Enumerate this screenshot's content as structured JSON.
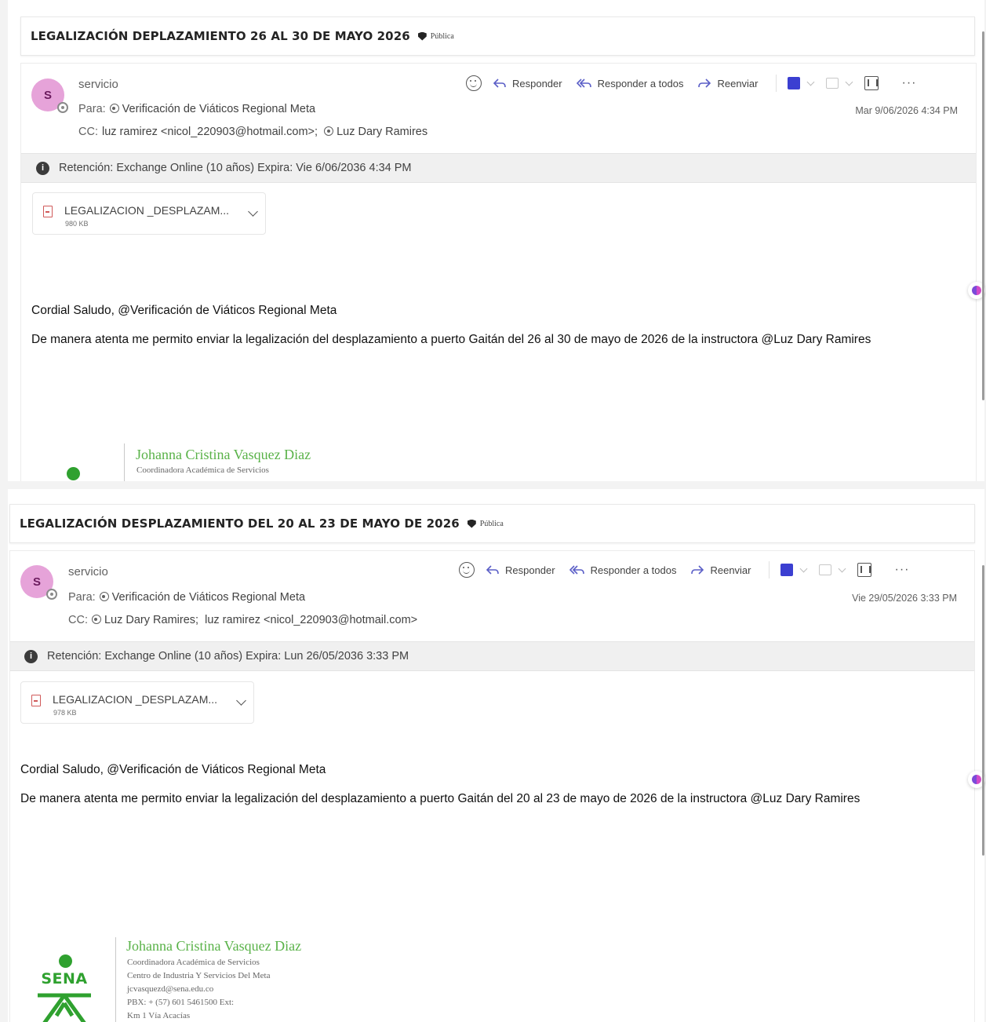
{
  "messages": [
    {
      "subject": "LEGALIZACIÓN DEPLAZAMIENTO 26 AL 30 DE MAYO 2026",
      "sensitivity": "Pública",
      "avatar_initial": "S",
      "sender": "servicio",
      "to_label": "Para:",
      "to": "Verificación de Viáticos Regional Meta",
      "cc_label": "CC:",
      "cc": [
        {
          "name": "luz ramirez <nicol_220903@hotmail.com>;",
          "icon": false
        },
        {
          "name": "Luz Dary Ramires",
          "icon": true
        }
      ],
      "date": "Mar 9/06/2026 4:34 PM",
      "retention": "Retención: Exchange Online (10 años) Expira: Vie 6/06/2036 4:34 PM",
      "attachment": {
        "name": "LEGALIZACION _DESPLAZAM...",
        "size": "980 KB"
      },
      "greeting": "Cordial Saludo, @Verificación de Viáticos Regional Meta",
      "body": "De manera atenta me permito enviar la legalización del desplazamiento a puerto Gaitán del 26 al 30 de mayo de 2026 de la instructora @Luz Dary Ramires",
      "signature": {
        "name": "Johanna Cristina Vasquez Diaz",
        "lines": [
          "Coordinadora Académica de Servicios"
        ]
      }
    },
    {
      "subject": "LEGALIZACIÓN DESPLAZAMIENTO DEL 20 AL 23 DE MAYO DE 2026",
      "sensitivity": "Pública",
      "avatar_initial": "S",
      "sender": "servicio",
      "to_label": "Para:",
      "to": "Verificación de Viáticos Regional Meta",
      "cc_label": "CC:",
      "cc": [
        {
          "name": "Luz Dary Ramires;",
          "icon": true
        },
        {
          "name": "luz ramirez <nicol_220903@hotmail.com>",
          "icon": false
        }
      ],
      "date": "Vie 29/05/2026 3:33 PM",
      "retention": "Retención: Exchange Online (10 años) Expira: Lun 26/05/2036 3:33 PM",
      "attachment": {
        "name": "LEGALIZACION _DESPLAZAM...",
        "size": "978 KB"
      },
      "greeting": "Cordial Saludo, @Verificación de Viáticos Regional Meta",
      "body": "De manera atenta me permito enviar la legalización del desplazamiento a puerto Gaitán del 20 al 23 de mayo de 2026 de la instructora @Luz Dary Ramires",
      "signature": {
        "name": "Johanna Cristina Vasquez Diaz",
        "lines": [
          "Coordinadora Académica de Servicios",
          "Centro de Industria Y Servicios Del Meta",
          "jcvasquezd@sena.edu.co",
          "PBX: + (57) 601 5461500 Ext:",
          "Km 1 Vía Acacías"
        ],
        "logo_text": "SENA"
      }
    }
  ],
  "toolbar": {
    "reply": "Responder",
    "reply_all": "Responder a todos",
    "forward": "Reenviar",
    "more": "···"
  },
  "icons": {
    "emoji": "smile-icon",
    "reply": "reply-arrow-icon",
    "reply_all": "reply-all-arrow-icon",
    "forward": "forward-arrow-icon",
    "pdf": "pdf-icon",
    "loop": "loop-icon",
    "immersive": "immersive-reader-icon",
    "more": "more-icon",
    "info": "info-icon",
    "copilot": "copilot-icon"
  },
  "colors": {
    "avatar_bg": "#e6a3d9",
    "signature_green": "#59b248",
    "sena_green": "#2fa12f",
    "pdf_blue": "#3b3fd1"
  }
}
